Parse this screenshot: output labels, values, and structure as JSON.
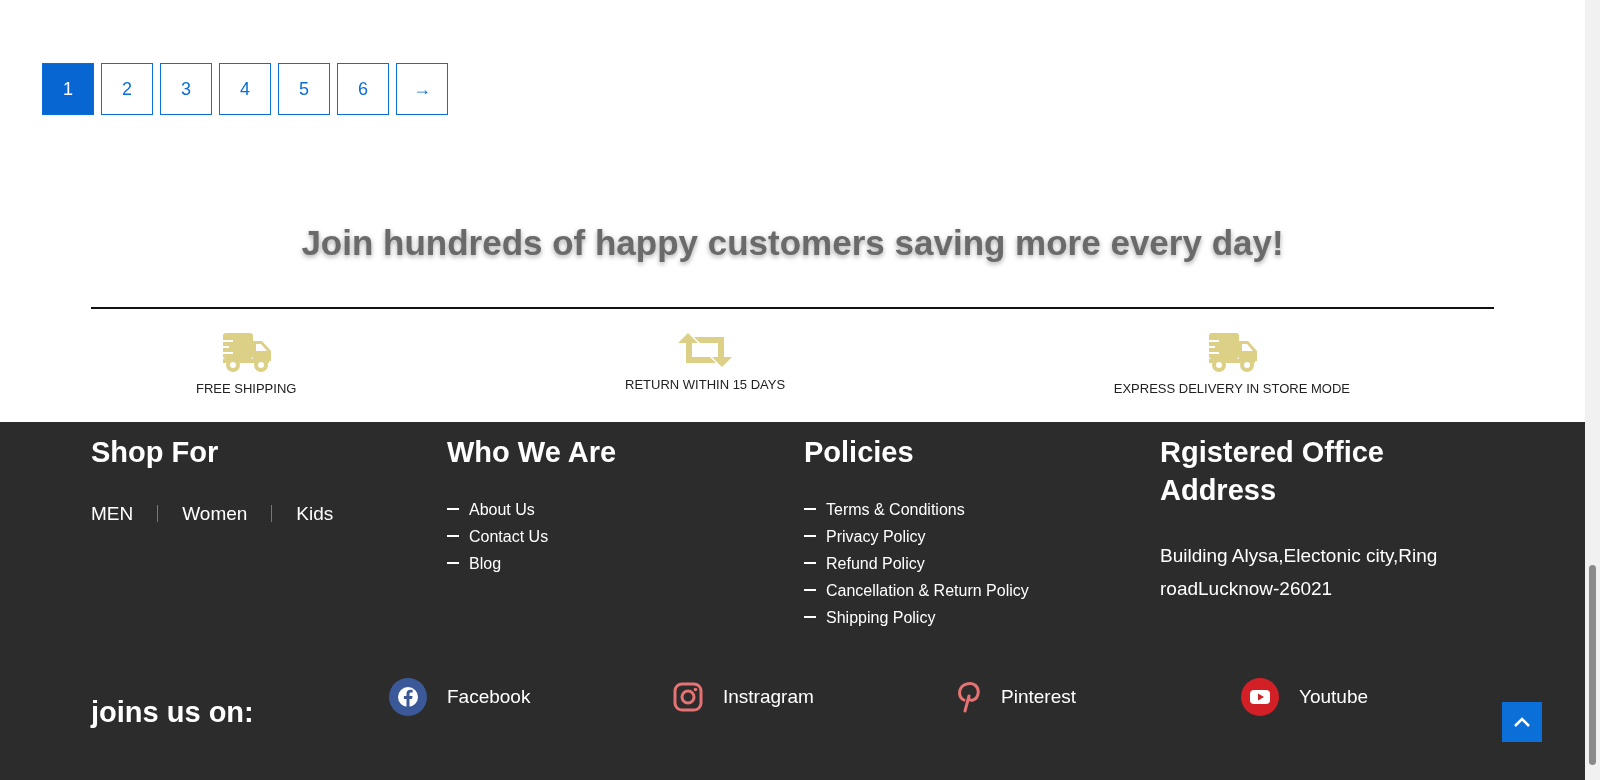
{
  "pagination": [
    {
      "label": "1",
      "selected": true
    },
    {
      "label": "2",
      "selected": false
    },
    {
      "label": "3",
      "selected": false
    },
    {
      "label": "4",
      "selected": false
    },
    {
      "label": "5",
      "selected": false
    },
    {
      "label": "6",
      "selected": false
    },
    {
      "label": "→",
      "selected": false
    }
  ],
  "tagline": "Join hundreds of happy customers saving more every day!",
  "features": [
    {
      "kind": "truck",
      "label": "FREE SHIPPING"
    },
    {
      "kind": "return",
      "label": "RETURN WITHIN 15 DAYS"
    },
    {
      "kind": "truck",
      "label": "EXPRESS DELIVERY IN STORE MODE"
    }
  ],
  "footer": {
    "shop_for": {
      "title": "Shop For",
      "links": [
        "MEN",
        "Women",
        "Kids"
      ]
    },
    "who_we_are": {
      "title": "Who We Are",
      "links": [
        "About Us",
        "Contact Us",
        "Blog"
      ]
    },
    "policies": {
      "title": "Policies",
      "links": [
        "Terms & Conditions",
        "Privacy Policy",
        "Refund Policy",
        "Cancellation & Return Policy",
        "Shipping Policy"
      ]
    },
    "office": {
      "title": "Rgistered Office Address",
      "address": "Building Alysa,Electonic city,Ring roadLucknow-26021"
    },
    "social_title": "joins us on:",
    "social": [
      {
        "kind": "facebook",
        "label": "Facebook"
      },
      {
        "kind": "instagram",
        "label": "Instragram"
      },
      {
        "kind": "pinterest",
        "label": "Pinterest"
      },
      {
        "kind": "youtube",
        "label": "Youtube"
      }
    ]
  }
}
